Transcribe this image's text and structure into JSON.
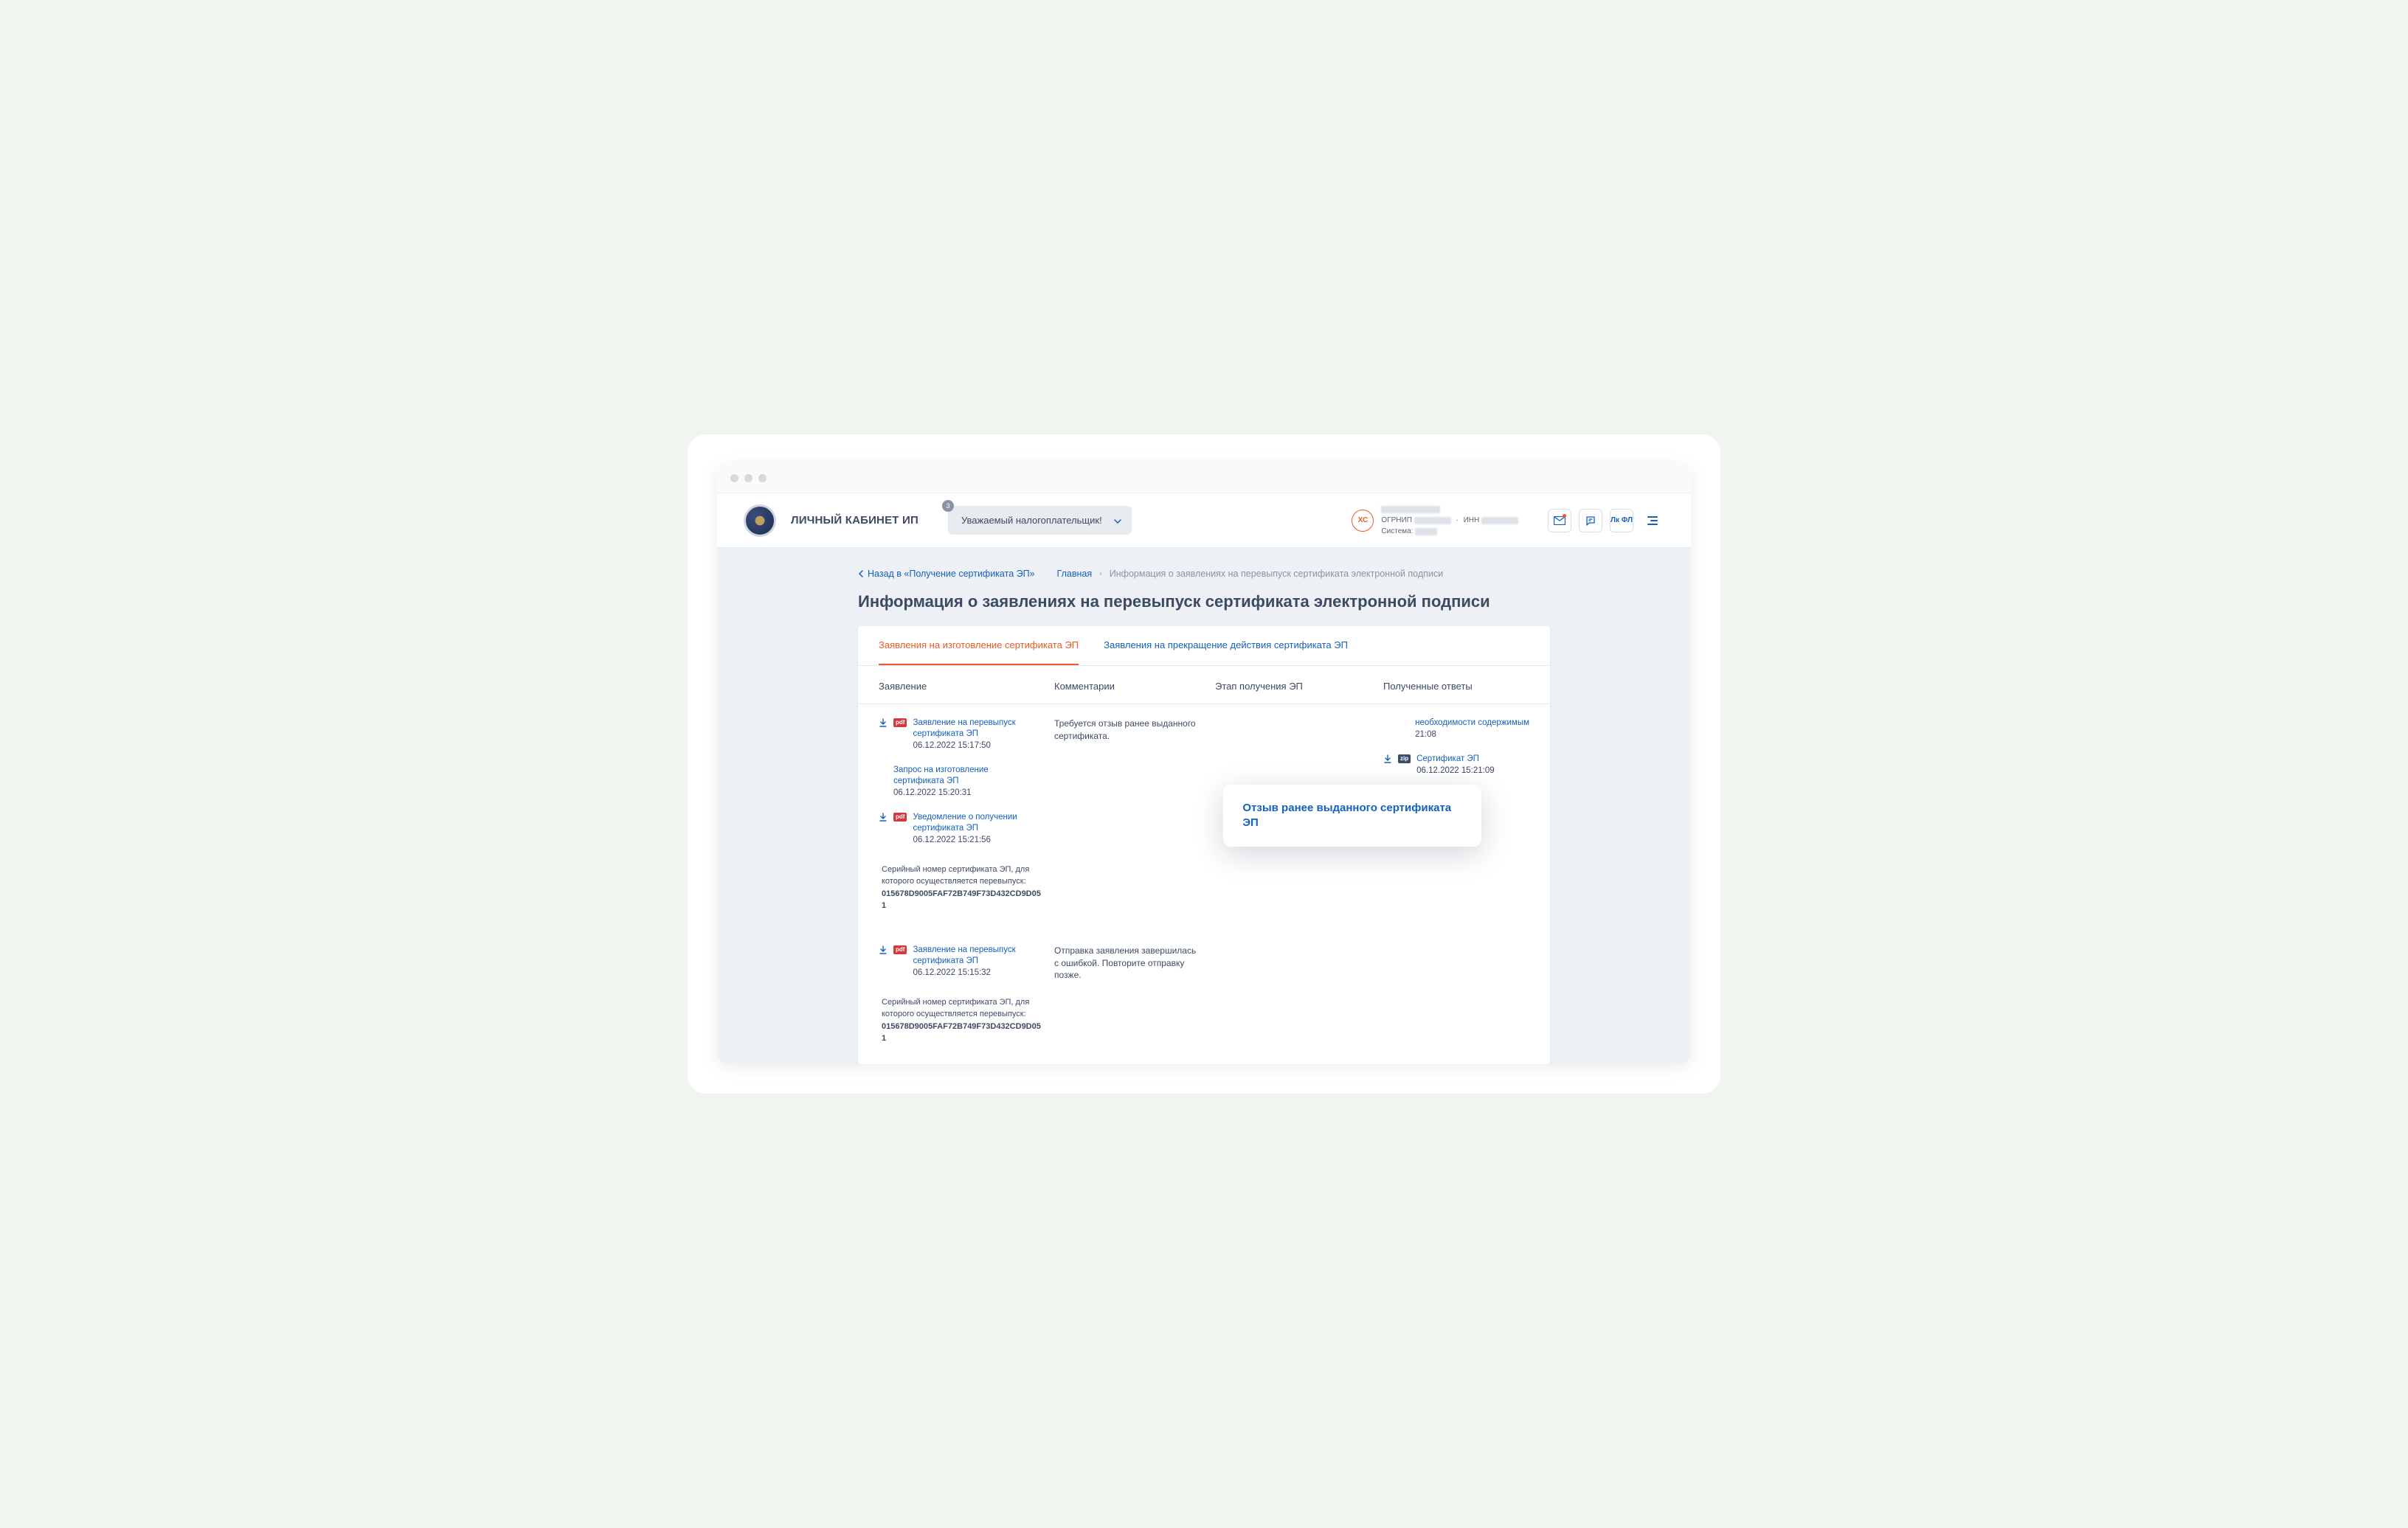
{
  "header": {
    "title": "ЛИЧНЫЙ КАБИНЕТ ИП",
    "greeting": "Уважаемый налогоплательщик!",
    "greeting_badge": "3",
    "avatar_initials": "ХС",
    "meta_ogrnip": "ОГРНИП",
    "meta_inn": "ИНН",
    "meta_system": "Система:",
    "lkfl": "Лк ФЛ"
  },
  "nav": {
    "back": "Назад в «Получение сертификата ЭП»",
    "home": "Главная",
    "current": "Информация о заявлениях на перевыпуск сертификата электронной подписи"
  },
  "page_title": "Информация о заявлениях на перевыпуск сертификата электронной подписи",
  "tabs": {
    "active": "Заявления на изготовление сертификата ЭП",
    "other": "Заявления на прекращение действия сертификата ЭП"
  },
  "columns": {
    "c1": "Заявление",
    "c2": "Комментарии",
    "c3": "Этап получения ЭП",
    "c4": "Полученные ответы"
  },
  "highlight": "Отзыв ранее выданного сертификата ЭП",
  "rows": [
    {
      "docs": [
        {
          "badge": "pdf",
          "link": "Заявление на перевыпуск сертификата ЭП",
          "date": "06.12.2022 15:17:50"
        },
        {
          "badge": "",
          "link": "Запрос на изготовление сертификата ЭП",
          "date": "06.12.2022 15:20:31"
        },
        {
          "badge": "pdf",
          "link": "Уведомление о получении сертификата ЭП",
          "date": "06.12.2022 15:21:56"
        }
      ],
      "comment": "Требуется отзыв ранее выданного сертификата.",
      "serial_label": "Серийный номер сертификата ЭП, для которого осуществляется перевыпуск:",
      "serial": "015678D9005FAF72B749F73D432CD9D051",
      "responses": [
        {
          "badge": "",
          "link_tail": "необходимости содержимым",
          "date_tail": "21:08"
        },
        {
          "badge": "zip",
          "link": "Сертификат ЭП",
          "date": "06.12.2022 15:21:09"
        }
      ]
    },
    {
      "docs": [
        {
          "badge": "pdf",
          "link": "Заявление на перевыпуск сертификата ЭП",
          "date": "06.12.2022 15:15:32"
        }
      ],
      "comment": "Отправка заявления завершилась с ошибкой. Повторите отправку позже.",
      "serial_label": "Серийный номер сертификата ЭП, для которого осуществляется перевыпуск:",
      "serial": "015678D9005FAF72B749F73D432CD9D051"
    }
  ]
}
